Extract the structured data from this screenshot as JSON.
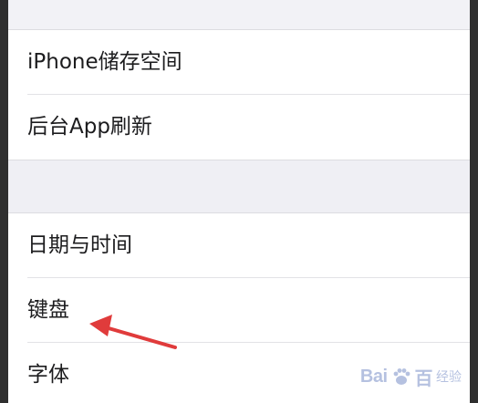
{
  "settings": {
    "group1": [
      {
        "label": "iPhone储存空间"
      },
      {
        "label": "后台App刷新"
      }
    ],
    "group2": [
      {
        "label": "日期与时间"
      },
      {
        "label": "键盘"
      },
      {
        "label": "字体"
      }
    ]
  },
  "annotation": {
    "arrow_color": "#e03b3b",
    "points_to": "键盘"
  },
  "watermark": {
    "brand": "Bai",
    "brand_suffix": "百",
    "sub": "经验"
  },
  "colors": {
    "background": "#efeff4",
    "row": "#ffffff",
    "separator": "#e2e2e6",
    "text": "#1c1c1e"
  }
}
